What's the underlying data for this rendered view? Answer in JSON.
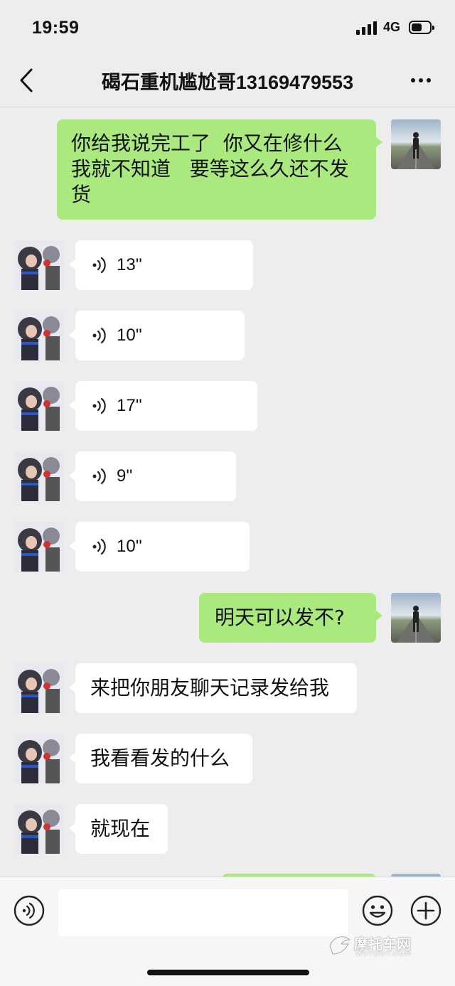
{
  "status_bar": {
    "time": "19:59",
    "network": "4G",
    "battery_level": 0.6
  },
  "header": {
    "title": "碣石重机尴尬哥13169479553",
    "back_icon": "chevron-left-icon",
    "more_icon": "more-dots-icon"
  },
  "colors": {
    "background": "#ededed",
    "sent_bubble": "#a9e97e",
    "received_bubble": "#ffffff"
  },
  "messages": [
    {
      "from": "me",
      "type": "text",
      "text": "你给我说完工了  你又在修什么\n我就不知道   要等这么久还不发\n货"
    },
    {
      "from": "contact",
      "type": "voice",
      "duration": "13''"
    },
    {
      "from": "contact",
      "type": "voice",
      "duration": "10''"
    },
    {
      "from": "contact",
      "type": "voice",
      "duration": "17''"
    },
    {
      "from": "contact",
      "type": "voice",
      "duration": "9''"
    },
    {
      "from": "contact",
      "type": "voice",
      "duration": "10''"
    },
    {
      "from": "me",
      "type": "text",
      "text": "明天可以发不?"
    },
    {
      "from": "contact",
      "type": "text",
      "text": "来把你朋友聊天记录发给我"
    },
    {
      "from": "contact",
      "type": "text",
      "text": "我看看发的什么"
    },
    {
      "from": "contact",
      "type": "text",
      "text": "就现在"
    }
  ],
  "input_bar": {
    "voice_icon": "voice-mode-icon",
    "input_value": "",
    "emoji_icon": "emoji-icon",
    "plus_icon": "plus-icon"
  },
  "watermark": {
    "main": "摩托车网",
    "sub": "MOTOOY.COM"
  }
}
